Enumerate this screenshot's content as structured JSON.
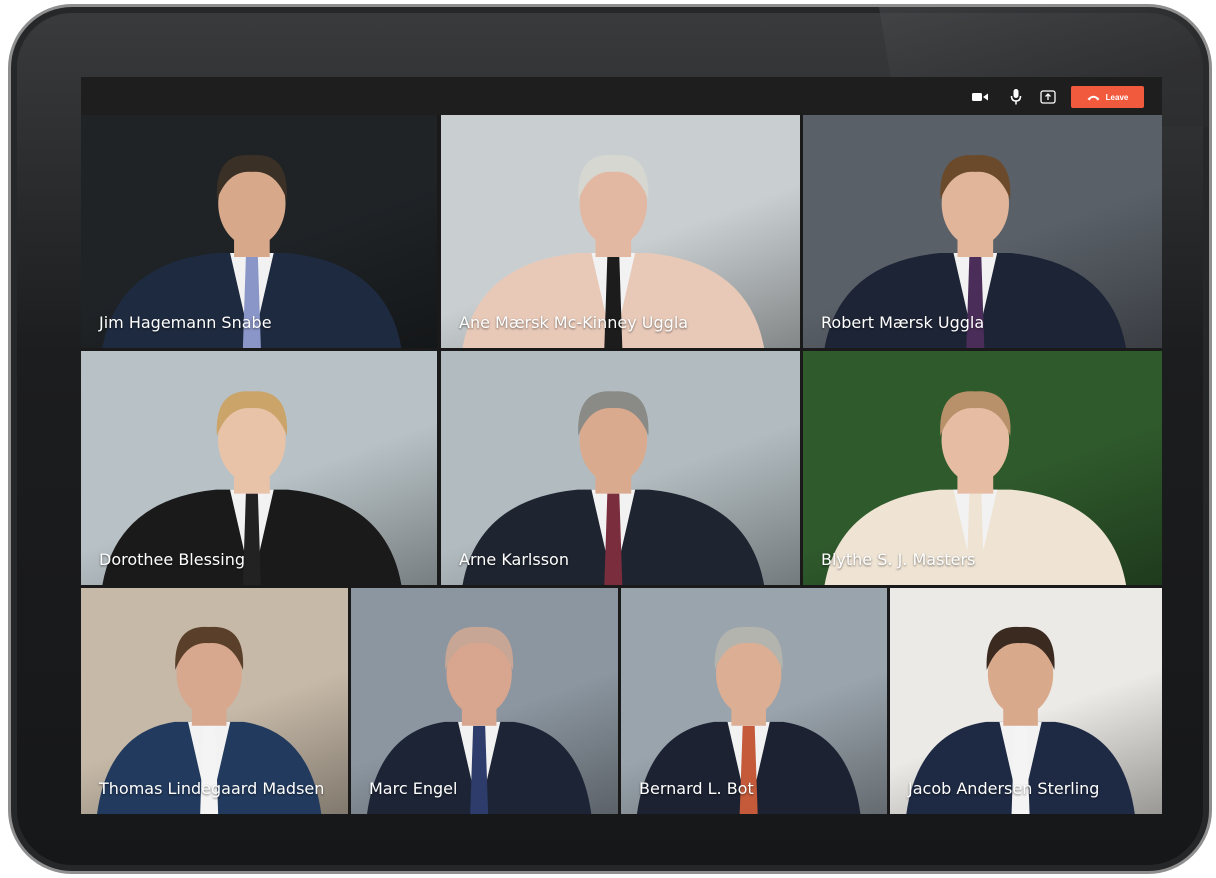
{
  "toolbar": {
    "icons": [
      "video-camera-icon",
      "microphone-icon",
      "share-screen-icon"
    ],
    "leave_label": "Leave",
    "leave_color": "#f25a3e"
  },
  "participants": [
    {
      "name": "Jim Hagemann Snabe",
      "bg": "#1f2326",
      "suit": "#1e2a3f",
      "hair": "#3b3026",
      "skin": "#d7a98a",
      "tie": "#8a96c8"
    },
    {
      "name": "Ane Mærsk Mc-Kinney Uggla",
      "bg": "#c9cfd1",
      "suit": "#e8c9b8",
      "hair": "#d7d7d1",
      "skin": "#e2b8a2",
      "tie": "#1c1c1c"
    },
    {
      "name": "Robert Mærsk Uggla",
      "bg": "#5a6068",
      "suit": "#1d2436",
      "hair": "#6b4a2c",
      "skin": "#e1b59a",
      "tie": "#4b2d5a"
    },
    {
      "name": "Dorothee Blessing",
      "bg": "#b8c2c6",
      "suit": "#1a1a1a",
      "hair": "#cba46a",
      "skin": "#e8c3a8",
      "tie": "#222"
    },
    {
      "name": "Arne Karlsson",
      "bg": "#b2bcc0",
      "suit": "#1e2430",
      "hair": "#8a8a86",
      "skin": "#d9aa8e",
      "tie": "#7a2d3c"
    },
    {
      "name": "Blythe S. J. Masters",
      "bg": "#2f5a2c",
      "suit": "#efe4d4",
      "hair": "#b8906a",
      "skin": "#e6bca2",
      "tie": "#efe4d4"
    },
    {
      "name": "Thomas Lindegaard Madsen",
      "bg": "#c6b9a8",
      "suit": "#223a5e",
      "hair": "#5a3f2a",
      "skin": "#d7a88e",
      "tie": "#f4f4f4"
    },
    {
      "name": "Marc Engel",
      "bg": "#8c96a0",
      "suit": "#1c2436",
      "hair": "#c8a696",
      "skin": "#d8a58e",
      "tie": "#2d3c6a"
    },
    {
      "name": "Bernard L. Bot",
      "bg": "#9aa4ac",
      "suit": "#1c2232",
      "hair": "#b4b4ae",
      "skin": "#dcae94",
      "tie": "#c45a3a"
    },
    {
      "name": "Jacob Andersen Sterling",
      "bg": "#eceae6",
      "suit": "#1e2a44",
      "hair": "#3a2a20",
      "skin": "#d9a98c",
      "tie": "#f4f4f4"
    }
  ]
}
